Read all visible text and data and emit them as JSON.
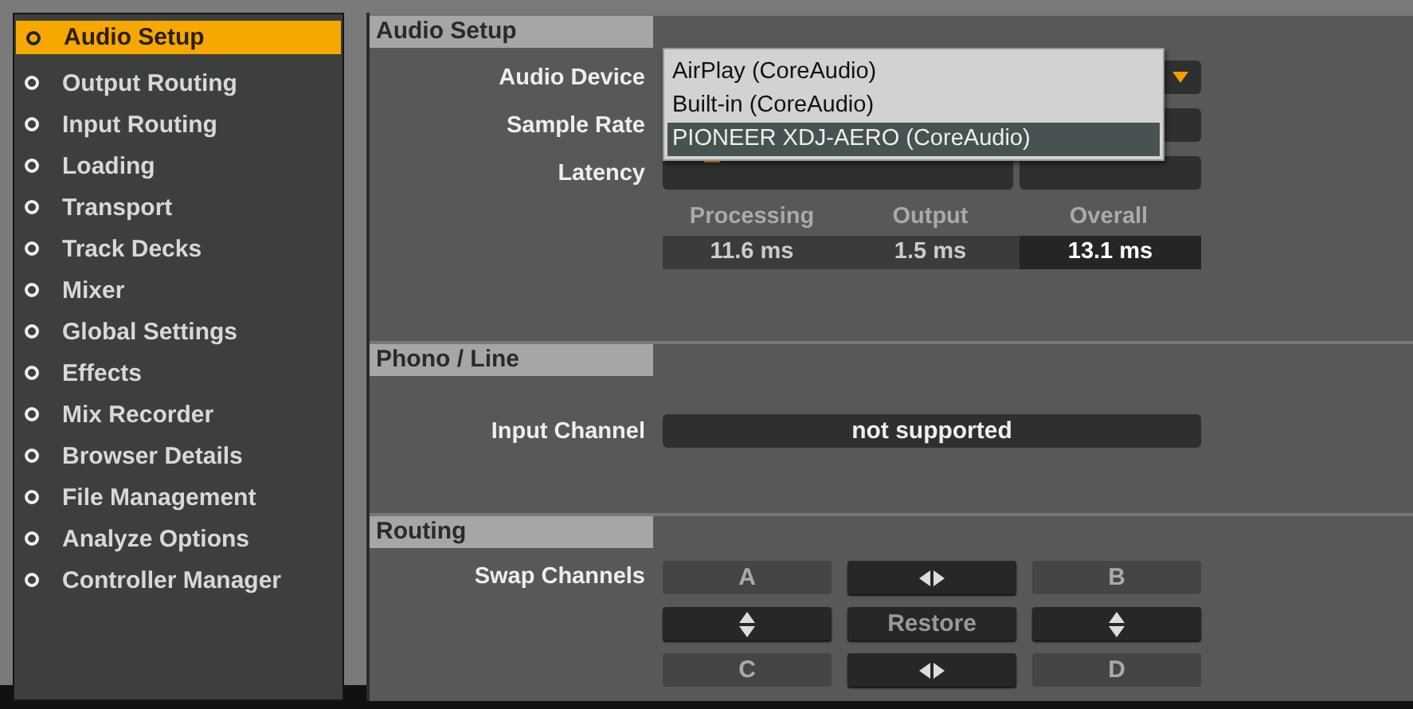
{
  "sidebar": {
    "items": [
      {
        "label": "Audio Setup",
        "selected": true
      },
      {
        "label": "Output Routing",
        "selected": false
      },
      {
        "label": "Input Routing",
        "selected": false
      },
      {
        "label": "Loading",
        "selected": false
      },
      {
        "label": "Transport",
        "selected": false
      },
      {
        "label": "Track Decks",
        "selected": false
      },
      {
        "label": "Mixer",
        "selected": false
      },
      {
        "label": "Global Settings",
        "selected": false
      },
      {
        "label": "Effects",
        "selected": false
      },
      {
        "label": "Mix Recorder",
        "selected": false
      },
      {
        "label": "Browser Details",
        "selected": false
      },
      {
        "label": "File Management",
        "selected": false
      },
      {
        "label": "Analyze Options",
        "selected": false
      },
      {
        "label": "Controller Manager",
        "selected": false
      }
    ]
  },
  "audio_setup": {
    "title": "Audio Setup",
    "audio_device_label": "Audio Device",
    "sample_rate_label": "Sample Rate",
    "latency_label": "Latency",
    "latency": {
      "level": 0.12
    },
    "device_menu": [
      {
        "label": "AirPlay (CoreAudio)",
        "selected": false
      },
      {
        "label": "Built-in (CoreAudio)",
        "selected": false
      },
      {
        "label": "PIONEER XDJ-AERO (CoreAudio)",
        "selected": true
      }
    ],
    "latency_columns": [
      {
        "heading": "Processing",
        "value": "11.6 ms",
        "highlighted": false
      },
      {
        "heading": "Output",
        "value": "1.5 ms",
        "highlighted": false
      },
      {
        "heading": "Overall",
        "value": "13.1 ms",
        "highlighted": true
      }
    ]
  },
  "phono_line": {
    "title": "Phono / Line",
    "input_channel_label": "Input Channel",
    "input_channel_value": "not supported"
  },
  "routing": {
    "title": "Routing",
    "swap_channels_label": "Swap Channels",
    "buttons": [
      {
        "kind": "letter",
        "label": "A"
      },
      {
        "kind": "swap-h"
      },
      {
        "kind": "letter",
        "label": "B"
      },
      {
        "kind": "swap-v"
      },
      {
        "kind": "text",
        "label": "Restore"
      },
      {
        "kind": "swap-v"
      },
      {
        "kind": "letter",
        "label": "C"
      },
      {
        "kind": "swap-h"
      },
      {
        "kind": "letter",
        "label": "D"
      }
    ]
  }
}
